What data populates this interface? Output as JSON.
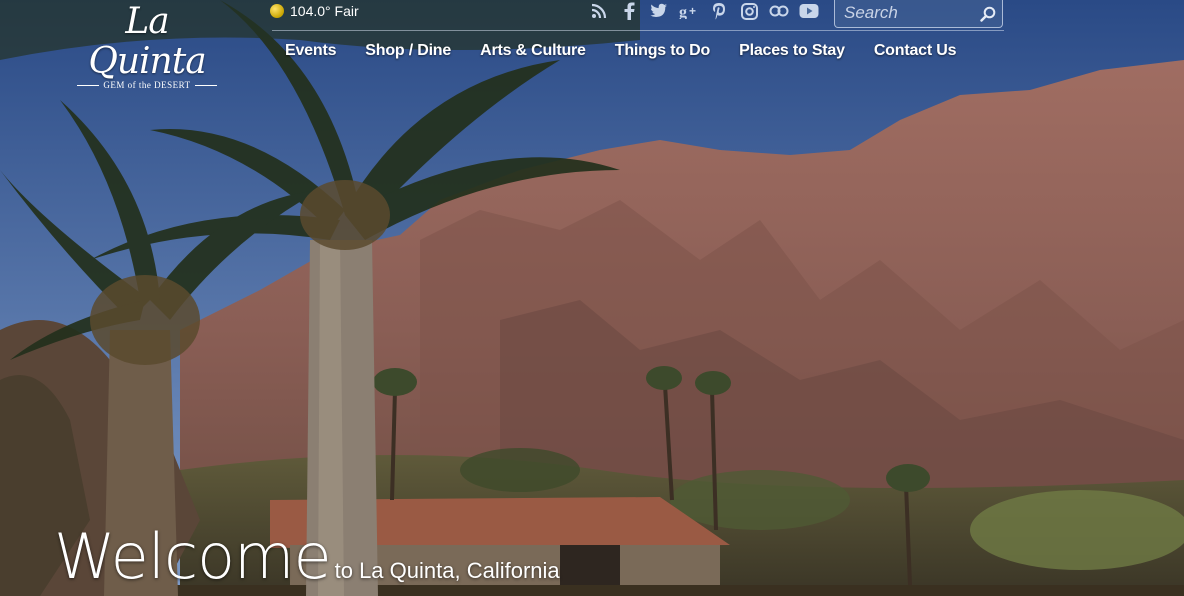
{
  "logo": {
    "title": "La Quinta",
    "tagline": "GEM of the DESERT"
  },
  "weather": {
    "text": "104.0° Fair",
    "icon": "sun-icon"
  },
  "social": [
    "rss-icon",
    "facebook-icon",
    "twitter-icon",
    "google-plus-icon",
    "pinterest-icon",
    "instagram-icon",
    "flickr-icon",
    "youtube-icon"
  ],
  "search": {
    "placeholder": "Search",
    "icon": "search-icon"
  },
  "nav": {
    "items": [
      "Events",
      "Shop / Dine",
      "Arts & Culture",
      "Things to Do",
      "Places to Stay",
      "Contact Us"
    ]
  },
  "hero": {
    "welcome": "Welcome",
    "subtitle": "to La Quinta, California"
  }
}
